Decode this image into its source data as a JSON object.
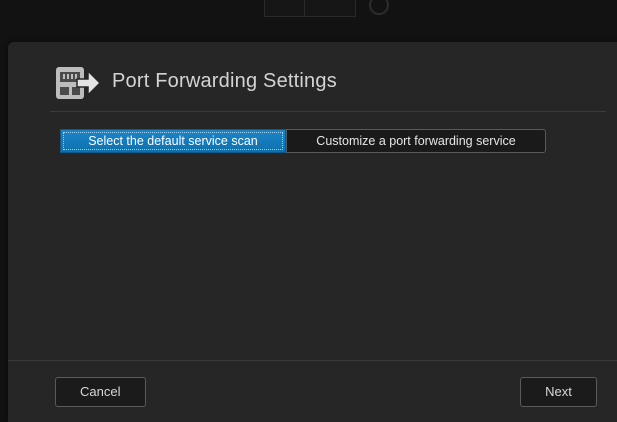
{
  "dialog": {
    "title": "Port Forwarding Settings",
    "title_icon": "port-forwarding-icon"
  },
  "tabs": [
    {
      "label": "Select the default service scan",
      "selected": true
    },
    {
      "label": "Customize a port forwarding service",
      "selected": false
    }
  ],
  "footer": {
    "cancel_label": "Cancel",
    "next_label": "Next"
  },
  "colors": {
    "accent": "#1479bd",
    "dialog_bg": "#262626",
    "text": "#d4d4d4"
  }
}
